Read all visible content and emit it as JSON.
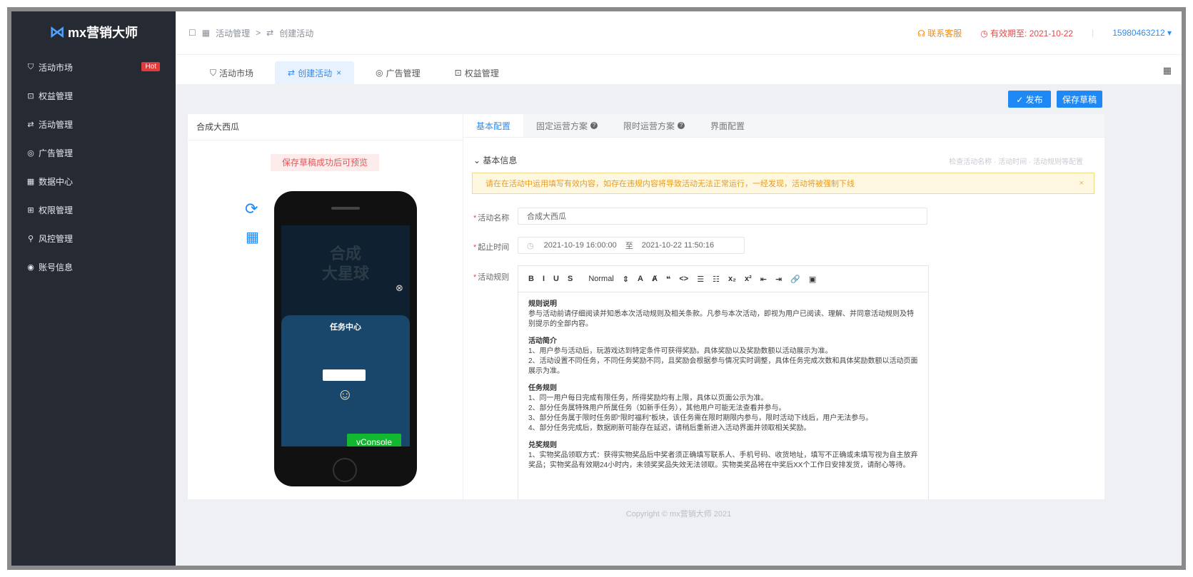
{
  "app": {
    "logo_mark": "⋈",
    "logo_text": "mx营销大师"
  },
  "sidebar": {
    "items": [
      {
        "label": "活动市场",
        "icon": "cart-icon",
        "glyph": "⛉",
        "badge": "Hot"
      },
      {
        "label": "权益管理",
        "icon": "gift-icon",
        "glyph": "⊡"
      },
      {
        "label": "活动管理",
        "icon": "activity-icon",
        "glyph": "⇄"
      },
      {
        "label": "广告管理",
        "icon": "ad-icon",
        "glyph": "◎"
      },
      {
        "label": "数据中心",
        "icon": "chart-icon",
        "glyph": "▦"
      },
      {
        "label": "权限管理",
        "icon": "permission-icon",
        "glyph": "⊞"
      },
      {
        "label": "风控管理",
        "icon": "risk-icon",
        "glyph": "⚲"
      },
      {
        "label": "账号信息",
        "icon": "account-icon",
        "glyph": "◉"
      }
    ]
  },
  "header": {
    "breadcrumb": [
      "活动管理",
      "创建活动"
    ],
    "breadcrumb_sep": ">",
    "contact": "联系客服",
    "expiry": "有效期至: 2021-10-22",
    "account": "15980463212 ▾"
  },
  "tabs": [
    {
      "label": "活动市场",
      "glyph": "⛉"
    },
    {
      "label": "创建活动",
      "glyph": "⇄",
      "close": "×"
    },
    {
      "label": "广告管理",
      "glyph": "◎"
    },
    {
      "label": "权益管理",
      "glyph": "⊡"
    }
  ],
  "actions": {
    "publish": "✓ 发布",
    "save_draft": "保存草稿"
  },
  "preview": {
    "title": "合成大西瓜",
    "note": "保存草稿成功后可预览",
    "game_title_1": "合成",
    "game_title_2": "大星球",
    "task_center": "任务中心",
    "vconsole": "vConsole"
  },
  "config": {
    "tabs": [
      "基本配置",
      "固定运营方案",
      "限时运营方案",
      "界面配置"
    ],
    "section": "基本信息",
    "section_hint": "检查活动名称 · 活动时间 · 活动规则等配置",
    "alert": "请在在活动中运用填写有效内容，如存在违规内容将导致活动无法正常运行，一经发现，活动将被强制下线",
    "alert_close": "×",
    "labels": {
      "name": "活动名称",
      "time": "起止时间",
      "rules": "活动规则"
    },
    "name_value": "合成大西瓜",
    "start_time": "2021-10-19 16:00:00",
    "time_sep": "至",
    "end_time": "2021-10-22 11:50:16",
    "toolbar": [
      "B",
      "I",
      "U",
      "S",
      "Normal",
      "⇕",
      "A",
      "Ⱥ",
      "❝",
      "<>",
      "☰",
      "☷",
      "x₂",
      "x²",
      "⇤",
      "⇥",
      "🔗",
      "▣"
    ],
    "rules": [
      {
        "head": "规则说明",
        "lines": [
          "参与活动前请仔细阅读并知悉本次活动规则及相关条款。凡参与本次活动，即视为用户已阅读、理解、并同意活动规则及特别提示的全部内容。"
        ]
      },
      {
        "head": "活动简介",
        "lines": [
          "1、用户参与活动后，玩游戏达到特定条件可获得奖励。具体奖励以及奖励数额以活动展示为准。",
          "2、活动设置不同任务，不同任务奖励不同，且奖励会根据参与情况实时调整，具体任务完成次数和具体奖励数额以活动页面展示为准。"
        ]
      },
      {
        "head": "任务规则",
        "lines": [
          "1、同一用户每日完成有限任务，所得奖励均有上限，具体以页面公示为准。",
          "2、部分任务属特殊用户所属任务（如新手任务），其他用户可能无法查看并参与。",
          "3、部分任务属于限时任务即“限时福利”板块，该任务需在限时期限内参与，限时活动下线后，用户无法参与。",
          "4、部分任务完成后，数据刷新可能存在延迟，请稍后重新进入活动界面并领取相关奖励。"
        ]
      },
      {
        "head": "兑奖规则",
        "lines": [
          "1、实物奖品领取方式：获得实物奖品后中奖者须正确填写联系人、手机号码、收货地址，填写不正确或未填写视为自主放弃奖品；实物奖品有效期24小时内，未领奖奖品失效无法领取。实物类奖品将在中奖后XX个工作日安排发货，请耐心等待。"
        ]
      }
    ]
  },
  "footer": "Copyright © mx营销大师 2021"
}
